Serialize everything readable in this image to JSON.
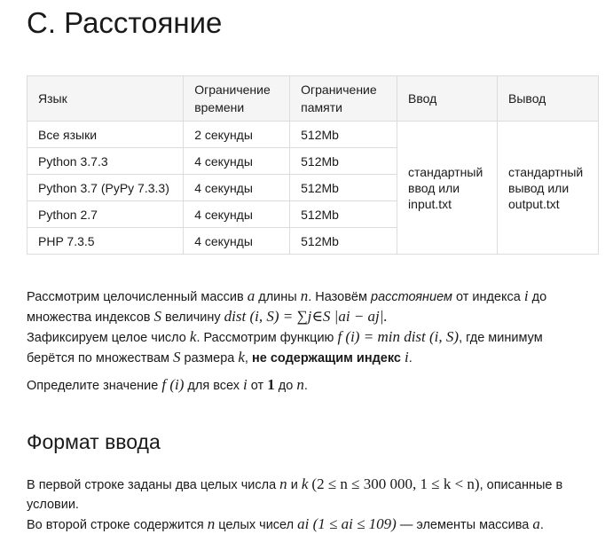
{
  "title": "C. Расстояние",
  "limits_table": {
    "headers": [
      "Язык",
      "Ограничение времени",
      "Ограничение памяти",
      "Ввод",
      "Вывод"
    ],
    "rows": [
      {
        "lang": "Все языки",
        "time": "2 секунды",
        "memory": "512Mb"
      },
      {
        "lang": "Python 3.7.3",
        "time": "4 секунды",
        "memory": "512Mb"
      },
      {
        "lang": "Python 3.7 (PyPy 7.3.3)",
        "time": "4 секунды",
        "memory": "512Mb"
      },
      {
        "lang": "Python 2.7",
        "time": "4 секунды",
        "memory": "512Mb"
      },
      {
        "lang": "PHP 7.3.5",
        "time": "4 секунды",
        "memory": "512Mb"
      }
    ],
    "input": "стандартный ввод или input.txt",
    "output": "стандартный вывод или output.txt"
  },
  "statement": {
    "p1_a": "Рассмотрим целочисленный массив ",
    "p1_var_a": "a",
    "p1_b": " длины ",
    "p1_var_n": "n",
    "p1_c": ". Назовём ",
    "p1_em": "расстоянием",
    "p1_d": " от индекса ",
    "p1_var_i": "i",
    "p1_e": " до",
    "p2_a": "множества индексов ",
    "p2_var_S": "S",
    "p2_b": " величину ",
    "p2_formula": "dist (i, S) = ∑j∈S |ai − aj|.",
    "p3_a": "Зафиксируем целое число ",
    "p3_var_k": "k",
    "p3_b": ". Рассмотрим функцию ",
    "p3_formula": "f (i) = min dist (i, S)",
    "p3_c": ", где минимум",
    "p4_a": "берётся по множествам ",
    "p4_var_S": "S",
    "p4_b": " размера ",
    "p4_var_k": "k",
    "p4_c": ", ",
    "p4_strong": "не содержащим индекс",
    "p4_d": " ",
    "p4_var_i": "i",
    "p4_e": ".",
    "p5_a": "Определите значение ",
    "p5_formula": "f (i)",
    "p5_b": " для всех ",
    "p5_var_i": "i",
    "p5_c": " от ",
    "p5_one": "1",
    "p5_d": " до ",
    "p5_var_n": "n",
    "p5_e": "."
  },
  "input_format": {
    "heading": "Формат ввода",
    "l1_a": "В первой строке заданы два целых числа ",
    "l1_var_n": "n",
    "l1_b": " и ",
    "l1_var_k": "k",
    "l1_formula": "(2 ≤ n ≤ 300 000, 1 ≤ k < n)",
    "l1_c": ", описанные в",
    "l2": "условии.",
    "l3_a": "Во второй строке содержится ",
    "l3_var_n": "n",
    "l3_b": " целых чисел ",
    "l3_formula": "ai (1 ≤ ai ≤ 109)",
    "l3_c": " — элементы массива ",
    "l3_var_a": "a",
    "l3_d": "."
  }
}
